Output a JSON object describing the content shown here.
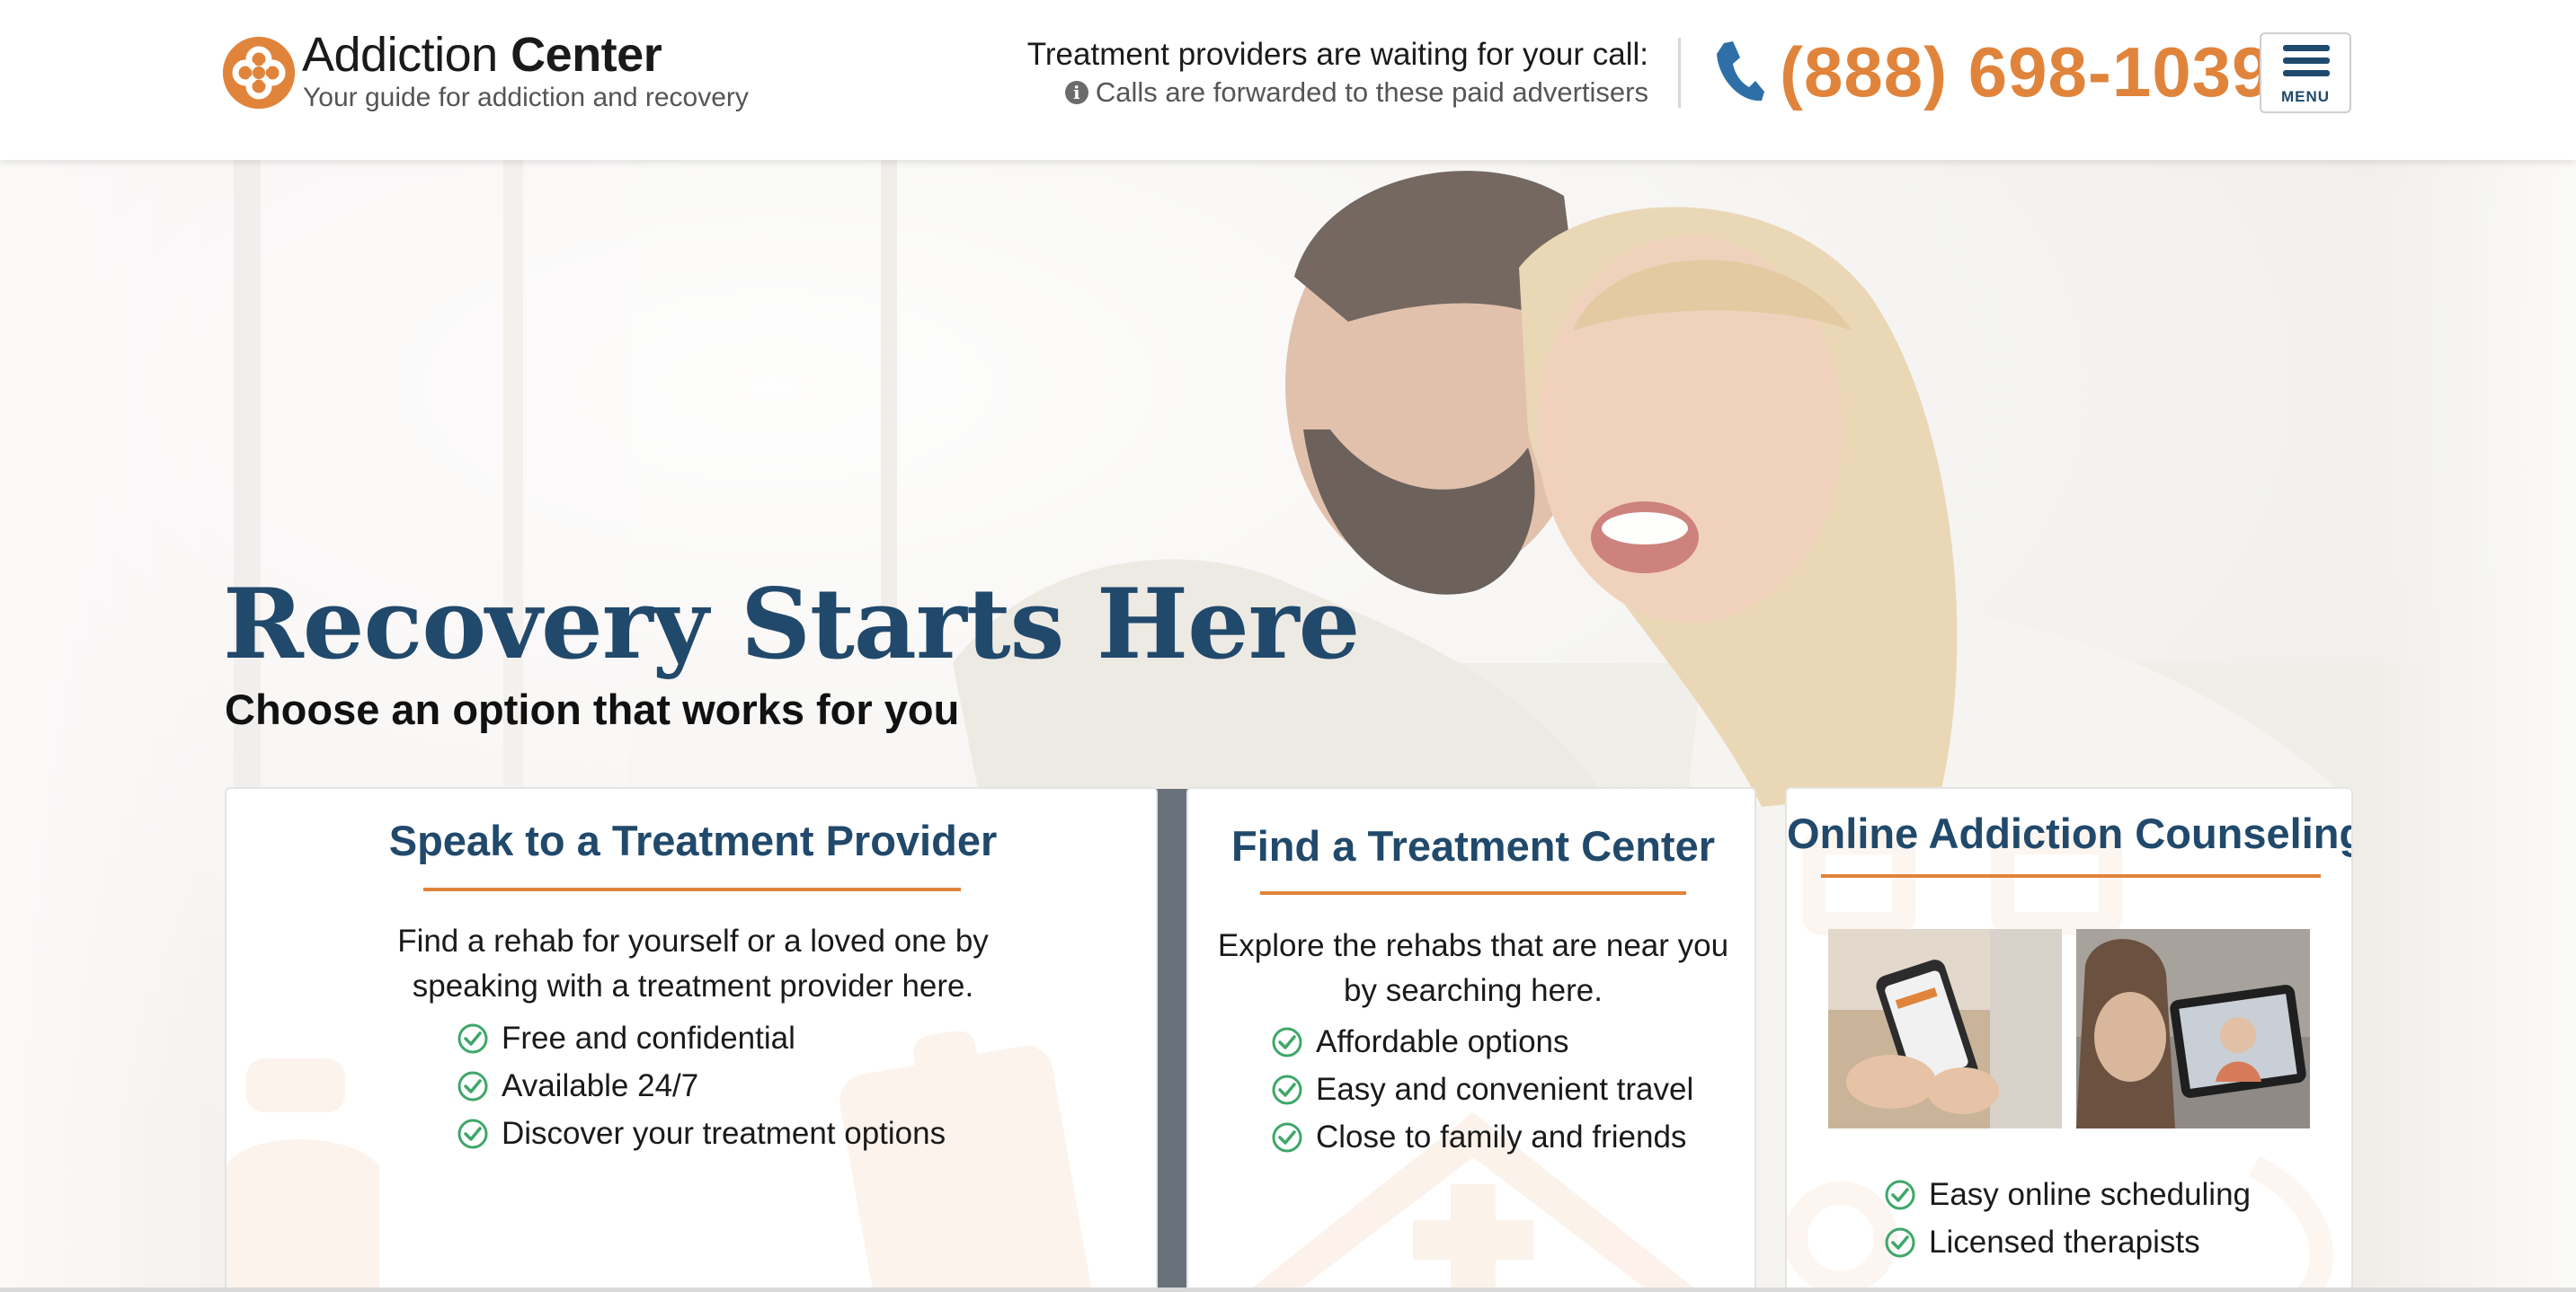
{
  "brand": {
    "name_light": "Addiction",
    "name_bold": "Center",
    "tagline": "Your guide for addiction and recovery",
    "accent": "#e0843c",
    "navy": "#21496b"
  },
  "header": {
    "waiting_text": "Treatment providers are waiting for your call:",
    "forwarded_text": "Calls are forwarded to these paid advertisers",
    "phone_number": "(888) 698-1039",
    "menu_label": "MENU"
  },
  "hero": {
    "title": "Recovery Starts Here",
    "subtitle": "Choose an option that works for you"
  },
  "cards": [
    {
      "title": "Speak to a Treatment Provider",
      "description": "Find a rehab for yourself or a loved one by speaking with a treatment provider here.",
      "bullets": [
        "Free and confidential",
        "Available 24/7",
        "Discover your treatment options"
      ]
    },
    {
      "title": "Find a Treatment Center",
      "description": "Explore the rehabs that are near you by searching here.",
      "bullets": [
        "Affordable options",
        "Easy and convenient travel",
        "Close to family and friends"
      ]
    },
    {
      "title": "Online Addiction Counseling",
      "bullets": [
        "Easy online scheduling",
        "Licensed therapists"
      ]
    }
  ],
  "icons": {
    "logo": "addiction-center-logo",
    "info": "info-circle-icon",
    "phone": "phone-icon",
    "menu": "hamburger-menu-icon",
    "check": "check-circle-icon"
  }
}
